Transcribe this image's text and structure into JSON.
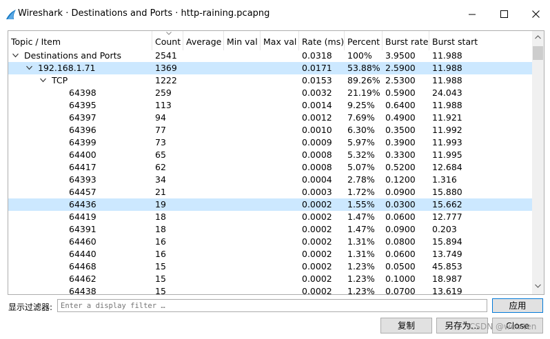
{
  "window": {
    "title": "Wireshark · Destinations and Ports · http-raining.pcapng",
    "minimize": "—",
    "maximize": "☐",
    "close": "✕"
  },
  "table": {
    "columns": [
      "Topic / Item",
      "Count",
      "Average",
      "Min val",
      "Max val",
      "Rate (ms)",
      "Percent",
      "Burst rate",
      "Burst start"
    ],
    "rows": [
      {
        "item": "Destinations and Ports",
        "level": 0,
        "expanded": true,
        "count": "2541",
        "avg": "",
        "min": "",
        "max": "",
        "rate": "0.0318",
        "pct": "100%",
        "burst": "3.9500",
        "start": "11.988",
        "selected": false
      },
      {
        "item": "192.168.1.71",
        "level": 1,
        "expanded": true,
        "count": "1369",
        "avg": "",
        "min": "",
        "max": "",
        "rate": "0.0171",
        "pct": "53.88%",
        "burst": "2.5900",
        "start": "11.988",
        "selected": true
      },
      {
        "item": "TCP",
        "level": 2,
        "expanded": true,
        "count": "1222",
        "avg": "",
        "min": "",
        "max": "",
        "rate": "0.0153",
        "pct": "89.26%",
        "burst": "2.5300",
        "start": "11.988",
        "selected": false
      },
      {
        "item": "64398",
        "level": 3,
        "count": "259",
        "avg": "",
        "min": "",
        "max": "",
        "rate": "0.0032",
        "pct": "21.19%",
        "burst": "0.5900",
        "start": "24.043",
        "selected": false
      },
      {
        "item": "64395",
        "level": 3,
        "count": "113",
        "avg": "",
        "min": "",
        "max": "",
        "rate": "0.0014",
        "pct": "9.25%",
        "burst": "0.6400",
        "start": "11.988",
        "selected": false
      },
      {
        "item": "64397",
        "level": 3,
        "count": "94",
        "avg": "",
        "min": "",
        "max": "",
        "rate": "0.0012",
        "pct": "7.69%",
        "burst": "0.4900",
        "start": "11.921",
        "selected": false
      },
      {
        "item": "64396",
        "level": 3,
        "count": "77",
        "avg": "",
        "min": "",
        "max": "",
        "rate": "0.0010",
        "pct": "6.30%",
        "burst": "0.3500",
        "start": "11.992",
        "selected": false
      },
      {
        "item": "64399",
        "level": 3,
        "count": "73",
        "avg": "",
        "min": "",
        "max": "",
        "rate": "0.0009",
        "pct": "5.97%",
        "burst": "0.3900",
        "start": "11.993",
        "selected": false
      },
      {
        "item": "64400",
        "level": 3,
        "count": "65",
        "avg": "",
        "min": "",
        "max": "",
        "rate": "0.0008",
        "pct": "5.32%",
        "burst": "0.3300",
        "start": "11.995",
        "selected": false
      },
      {
        "item": "64417",
        "level": 3,
        "count": "62",
        "avg": "",
        "min": "",
        "max": "",
        "rate": "0.0008",
        "pct": "5.07%",
        "burst": "0.5200",
        "start": "12.684",
        "selected": false
      },
      {
        "item": "64393",
        "level": 3,
        "count": "34",
        "avg": "",
        "min": "",
        "max": "",
        "rate": "0.0004",
        "pct": "2.78%",
        "burst": "0.1200",
        "start": "1.316",
        "selected": false
      },
      {
        "item": "64457",
        "level": 3,
        "count": "21",
        "avg": "",
        "min": "",
        "max": "",
        "rate": "0.0003",
        "pct": "1.72%",
        "burst": "0.0900",
        "start": "15.880",
        "selected": false
      },
      {
        "item": "64436",
        "level": 3,
        "count": "19",
        "avg": "",
        "min": "",
        "max": "",
        "rate": "0.0002",
        "pct": "1.55%",
        "burst": "0.0300",
        "start": "15.662",
        "selected": true
      },
      {
        "item": "64419",
        "level": 3,
        "count": "18",
        "avg": "",
        "min": "",
        "max": "",
        "rate": "0.0002",
        "pct": "1.47%",
        "burst": "0.0600",
        "start": "12.777",
        "selected": false
      },
      {
        "item": "64391",
        "level": 3,
        "count": "18",
        "avg": "",
        "min": "",
        "max": "",
        "rate": "0.0002",
        "pct": "1.47%",
        "burst": "0.0900",
        "start": "0.203",
        "selected": false
      },
      {
        "item": "64460",
        "level": 3,
        "count": "16",
        "avg": "",
        "min": "",
        "max": "",
        "rate": "0.0002",
        "pct": "1.31%",
        "burst": "0.0800",
        "start": "15.894",
        "selected": false
      },
      {
        "item": "64440",
        "level": 3,
        "count": "16",
        "avg": "",
        "min": "",
        "max": "",
        "rate": "0.0002",
        "pct": "1.31%",
        "burst": "0.0600",
        "start": "13.749",
        "selected": false
      },
      {
        "item": "64468",
        "level": 3,
        "count": "15",
        "avg": "",
        "min": "",
        "max": "",
        "rate": "0.0002",
        "pct": "1.23%",
        "burst": "0.0500",
        "start": "45.853",
        "selected": false
      },
      {
        "item": "64462",
        "level": 3,
        "count": "15",
        "avg": "",
        "min": "",
        "max": "",
        "rate": "0.0002",
        "pct": "1.23%",
        "burst": "0.1000",
        "start": "18.987",
        "selected": false
      },
      {
        "item": "64438",
        "level": 3,
        "count": "15",
        "avg": "",
        "min": "",
        "max": "",
        "rate": "0.0002",
        "pct": "1.23%",
        "burst": "0.0700",
        "start": "13.619",
        "selected": false
      }
    ]
  },
  "filter": {
    "label": "显示过滤器:",
    "placeholder": "Enter a display filter …",
    "apply_label": "应用"
  },
  "buttons": {
    "copy_label": "复制",
    "save_as_label": "另存为…",
    "close_label": "Close"
  },
  "watermark": "CSDN @weixten",
  "colors": {
    "selection": "#cce8ff",
    "accent": "#0078d7",
    "button_bg": "#e1e1e1"
  }
}
